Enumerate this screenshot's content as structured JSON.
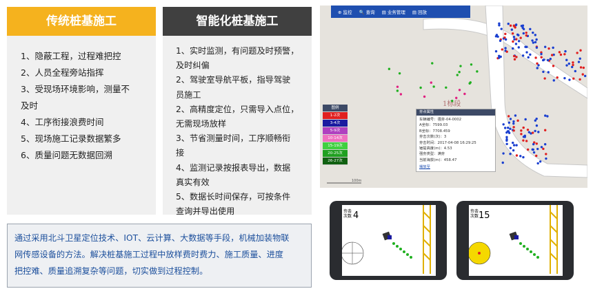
{
  "traditional": {
    "title": "传统桩基施工",
    "items": [
      "1、隐蔽工程，过程难把控",
      "2、人员全程旁站指挥",
      "3、受现场环境影响，测量不",
      "及时",
      "4、工序衔接浪费时间",
      "5、现场施工记录数据繁多",
      "6、质量问题无数据回溯"
    ]
  },
  "smart": {
    "title": "智能化桩基施工",
    "items": [
      "1、实时监测，有问题及时预警，",
      "及时纠偏",
      "2、驾驶室导航平板，指导驾驶",
      "员施工",
      "2、高精度定位，只需导入点位，",
      "无需现场放样",
      "3、节省测量时间，工序顺畅衔",
      "接",
      "4、监测记录按报表导出，数据",
      "真实有效",
      "5、数据长时间保存，可按条件",
      "查询并导出使用"
    ]
  },
  "description": [
    "通过采用北斗卫星定位技术、IOT、云计算、大数据等手段，机械加装物联",
    "网传感设备的方法。解决桩基施工过程中放样费时费力、施工质量、进度",
    "把控难、质量追溯复杂等问题，切实做到过程控制。"
  ],
  "map": {
    "toolbar": [
      "⊕ 监控",
      "🔍 查询",
      "▤ 业务管理",
      "▤ 回放"
    ],
    "area_label": "1标段",
    "scale_label": "100m",
    "legend_title": "图例",
    "legend": [
      {
        "label": "1-2次",
        "color": "#e02020"
      },
      {
        "label": "3-4次",
        "color": "#1a1aa0"
      },
      {
        "label": "5-9次",
        "color": "#b040c0"
      },
      {
        "label": "10-14次",
        "color": "#f070c0"
      },
      {
        "label": "15-19次",
        "color": "#40d040"
      },
      {
        "label": "20-25次",
        "color": "#20a020"
      },
      {
        "label": "26-27次",
        "color": "#106010"
      }
    ],
    "popup": {
      "title": "夯点属性",
      "rows": [
        "车辆编号：强夯-04-0002",
        "A坐标：7599.03",
        "B坐标：7708.459",
        "夯击次数(次)：3",
        "夯击时间：2017-04-08 16:29:25",
        "锤提高度(m)：4.53",
        "强夯类型：满夯",
        "当前海拔(m)：458.47"
      ],
      "link": "播放至"
    }
  },
  "tablets": [
    {
      "label": "夯击次数",
      "value": "4"
    },
    {
      "label": "夯击次数",
      "value": "15"
    }
  ]
}
